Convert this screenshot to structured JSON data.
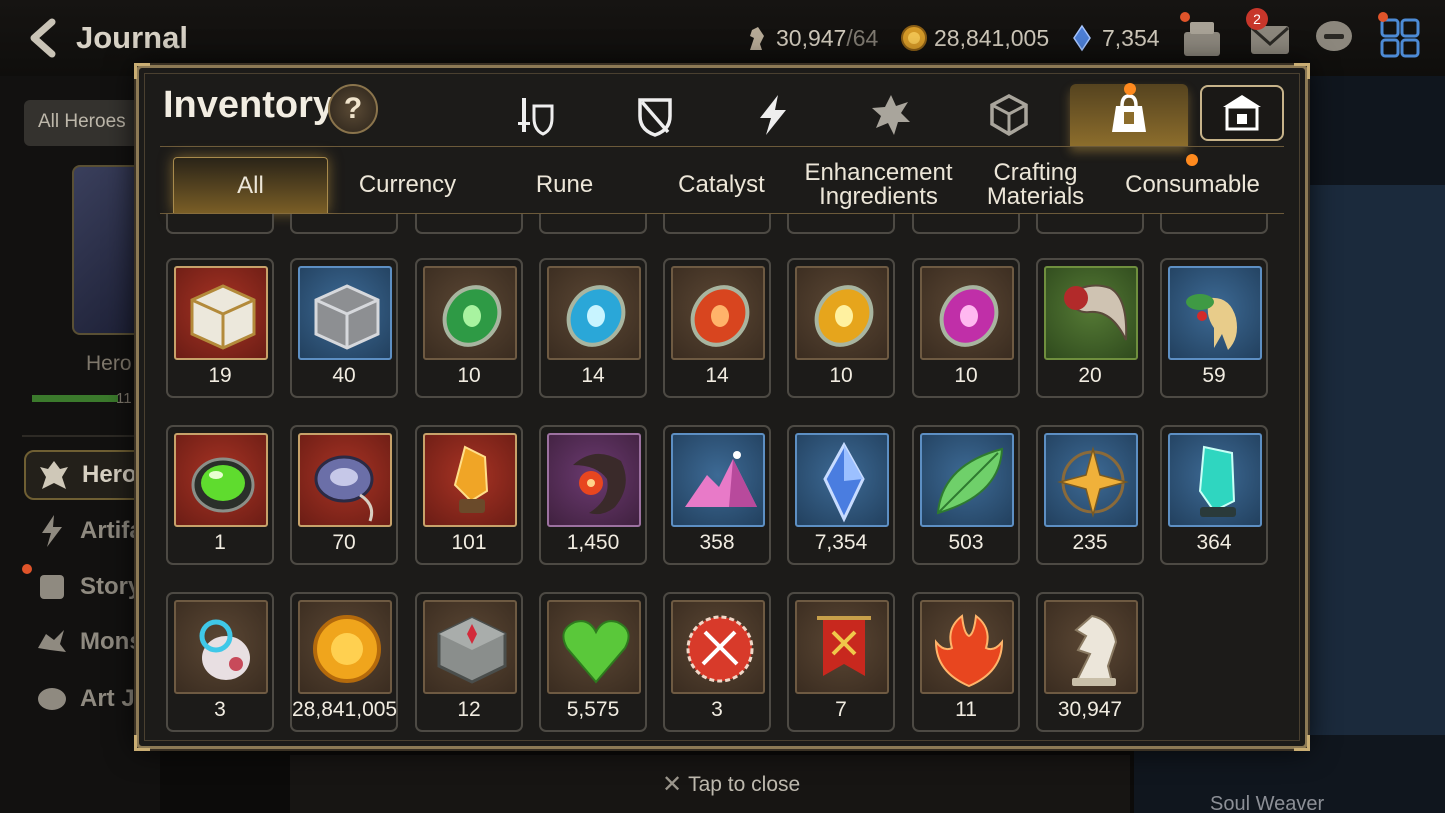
{
  "header": {
    "title": "Journal",
    "stamina": "30,947",
    "stamina_max": "/64",
    "gold": "28,841,005",
    "crystal": "7,354",
    "mail_count": "2"
  },
  "sidebar": {
    "filter_button": "All Heroes",
    "hero_label": "Hero",
    "hero_count": "11",
    "items": [
      {
        "label": "Hero J"
      },
      {
        "label": "Artifa"
      },
      {
        "label": "Story"
      },
      {
        "label": "Mons"
      },
      {
        "label": "Art Jo"
      }
    ]
  },
  "right_panel": {
    "soul_weaver": "Soul Weaver"
  },
  "inventory": {
    "title": "Inventory",
    "help": "?",
    "category_icons": [
      "equipment-icon",
      "shield-icon",
      "lightning-icon",
      "catalyst-icon",
      "cube-icon",
      "bag-icon",
      "storage-icon"
    ],
    "active_category": "bag-icon",
    "sub_tabs": [
      "All",
      "Currency",
      "Rune",
      "Catalyst",
      "Enhancement Ingredients",
      "Crafting Materials",
      "Consumable"
    ],
    "active_sub_tab": "All",
    "rows": [
      [
        {
          "icon": "gold-chest-icon",
          "qty": "19"
        },
        {
          "icon": "silver-chest-icon",
          "qty": "40"
        },
        {
          "icon": "green-rune-icon",
          "qty": "10"
        },
        {
          "icon": "blue-rune-icon",
          "qty": "14"
        },
        {
          "icon": "red-rune-icon",
          "qty": "14"
        },
        {
          "icon": "yellow-rune-icon",
          "qty": "10"
        },
        {
          "icon": "purple-rune-icon",
          "qty": "10"
        },
        {
          "icon": "claw-icon",
          "qty": "20"
        },
        {
          "icon": "ginseng-icon",
          "qty": "59"
        }
      ],
      [
        {
          "icon": "green-gem-icon",
          "qty": "1"
        },
        {
          "icon": "necklace-icon",
          "qty": "70"
        },
        {
          "icon": "amber-crystal-icon",
          "qty": "101"
        },
        {
          "icon": "flower-charm-icon",
          "qty": "1,450"
        },
        {
          "icon": "pink-crystal-icon",
          "qty": "358"
        },
        {
          "icon": "sky-stone-icon",
          "qty": "7,354"
        },
        {
          "icon": "leaf-icon",
          "qty": "503"
        },
        {
          "icon": "star-pendant-icon",
          "qty": "235"
        },
        {
          "icon": "teal-crystal-icon",
          "qty": "364"
        }
      ],
      [
        {
          "icon": "pet-egg-icon",
          "qty": "3"
        },
        {
          "icon": "gold-coin-icon",
          "qty": "28,841,005"
        },
        {
          "icon": "stone-cube-icon",
          "qty": "12"
        },
        {
          "icon": "heart-icon",
          "qty": "5,575"
        },
        {
          "icon": "badge-icon",
          "qty": "3"
        },
        {
          "icon": "banner-icon",
          "qty": "7"
        },
        {
          "icon": "flame-leaf-icon",
          "qty": "11"
        },
        {
          "icon": "horse-piece-icon",
          "qty": "30,947"
        }
      ]
    ]
  },
  "footer": {
    "close_hint": "Tap to close"
  },
  "colors": {
    "accent_gold": "#c9ad73",
    "panel": "#1c1b19",
    "tab_active": "#8c6d2c"
  }
}
